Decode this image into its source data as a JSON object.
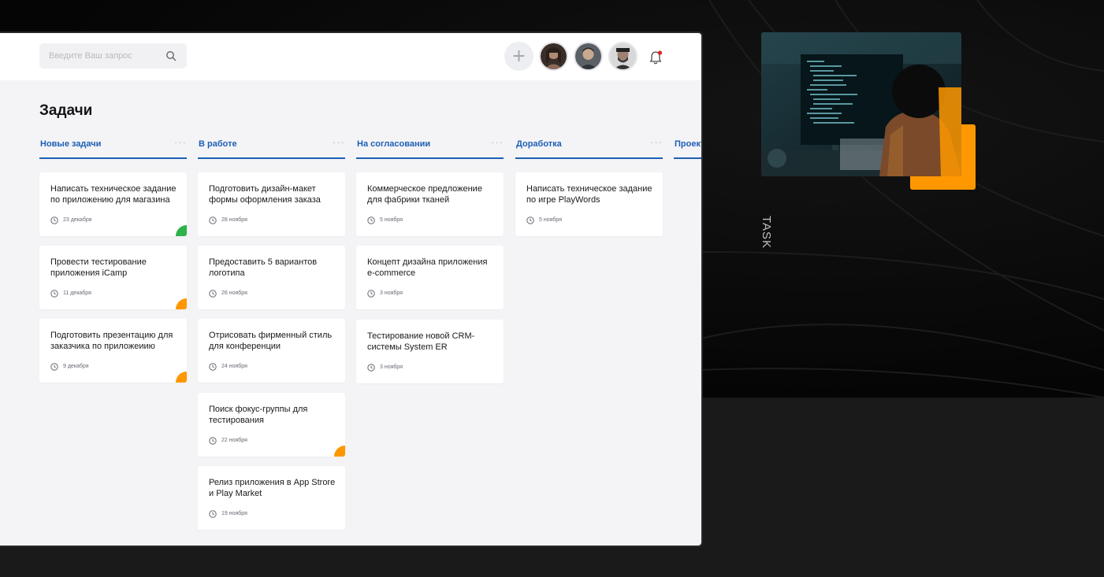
{
  "search": {
    "placeholder": "Введите Ваш запрос"
  },
  "page_title": "Задачи",
  "columns": [
    {
      "title": "Новые задачи",
      "more": "···",
      "cards": [
        {
          "title": "Написать техническое задание по приложению для магазина",
          "date": "23 декабря",
          "marker_color": "#2db34a"
        },
        {
          "title": "Провести тестирование приложения iCamp",
          "date": "11 декабря",
          "marker_color": "#ff9800"
        },
        {
          "title": "Подготовить презентацию для заказчика по приложеиию",
          "date": "9 декабря",
          "marker_color": "#ff9800"
        }
      ]
    },
    {
      "title": "В работе",
      "more": "···",
      "cards": [
        {
          "title": "Подготовить дизайн-макет формы оформления заказа",
          "date": "28 ноября"
        },
        {
          "title": "Предоставить 5 вариантов логотипа",
          "date": "26 ноября"
        },
        {
          "title": "Отрисовать фирменный стиль для конференции",
          "date": "24 ноября"
        },
        {
          "title": "Поиск фокус-группы для тестирования",
          "date": "22 ноября",
          "marker_color": "#ff9800"
        },
        {
          "title": "Релиз приложения в App Strore и Play Market",
          "date": "19 ноября"
        }
      ]
    },
    {
      "title": "На согласовании",
      "more": "···",
      "cards": [
        {
          "title": "Коммерческое предложение для фабрики тканей",
          "date": "5 ноября"
        },
        {
          "title": "Концепт дизайна приложения e-commerce",
          "date": "3 ноября"
        },
        {
          "title": "Тестирование новой  CRM-системы System ER",
          "date": "3 ноября"
        }
      ]
    },
    {
      "title": "Доработка",
      "more": "···",
      "cards": [
        {
          "title": "Написать техническое задание по игре PlayWords",
          "date": "5 ноября"
        }
      ]
    },
    {
      "title": "Проект",
      "cards": []
    }
  ],
  "side_label": "TASK",
  "colors": {
    "accent_blue": "#1d5fb4",
    "accent_orange": "#ff9800",
    "accent_green": "#2db34a",
    "notification_dot": "#e02424"
  }
}
